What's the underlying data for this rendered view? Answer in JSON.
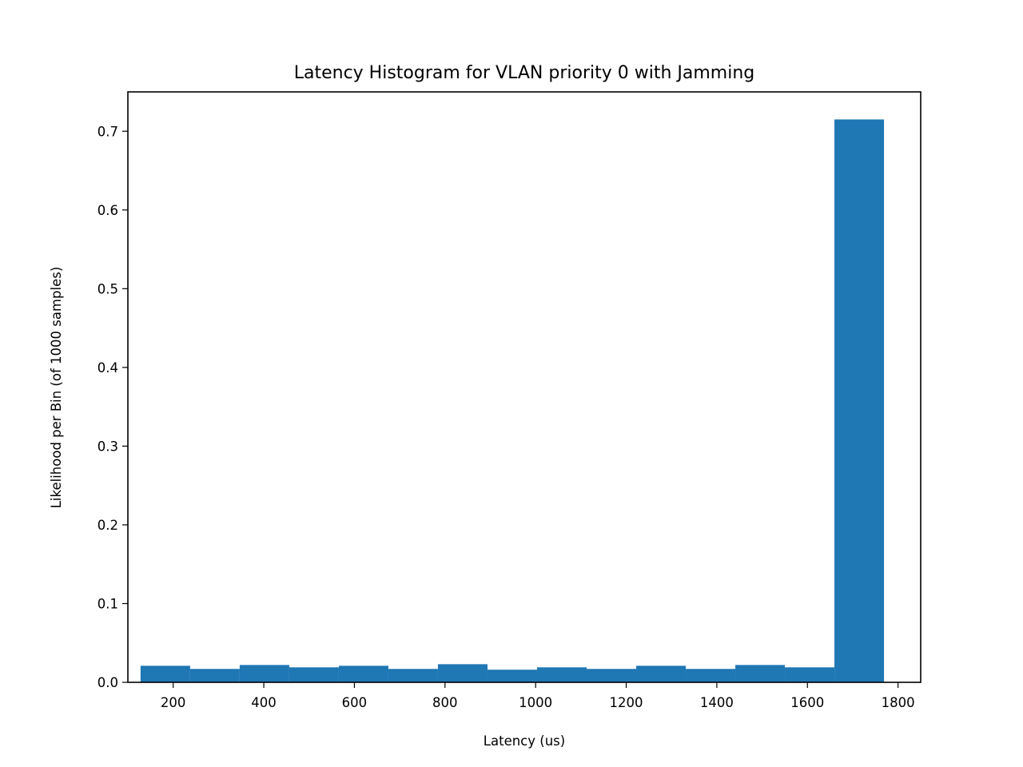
{
  "chart_data": {
    "type": "bar",
    "title": "Latency Histogram for VLAN priority 0 with Jamming",
    "xlabel": "Latency (us)",
    "ylabel": "Likelihood per Bin (of 1000 samples)",
    "xlim": [
      100,
      1850
    ],
    "ylim": [
      0.0,
      0.75
    ],
    "xticks": [
      200,
      400,
      600,
      800,
      1000,
      1200,
      1400,
      1600,
      1800
    ],
    "xtick_labels": [
      "200",
      "400",
      "600",
      "800",
      "1000",
      "1200",
      "1400",
      "1600",
      "1800"
    ],
    "yticks": [
      0.0,
      0.1,
      0.2,
      0.3,
      0.4,
      0.5,
      0.6,
      0.7
    ],
    "ytick_labels": [
      "0.0",
      "0.1",
      "0.2",
      "0.3",
      "0.4",
      "0.5",
      "0.6",
      "0.7"
    ],
    "bin_edges": [
      128,
      237.4,
      346.8,
      456.2,
      565.6,
      675,
      784.4,
      893.8,
      1003.2,
      1112.6,
      1222,
      1331.4,
      1440.8,
      1550.2,
      1659.6,
      1769
    ],
    "values": [
      0.021,
      0.017,
      0.022,
      0.019,
      0.021,
      0.017,
      0.023,
      0.016,
      0.019,
      0.017,
      0.021,
      0.017,
      0.022,
      0.019,
      0.715
    ],
    "bar_color": "#1f77b4",
    "grid": false,
    "legend": "none"
  }
}
